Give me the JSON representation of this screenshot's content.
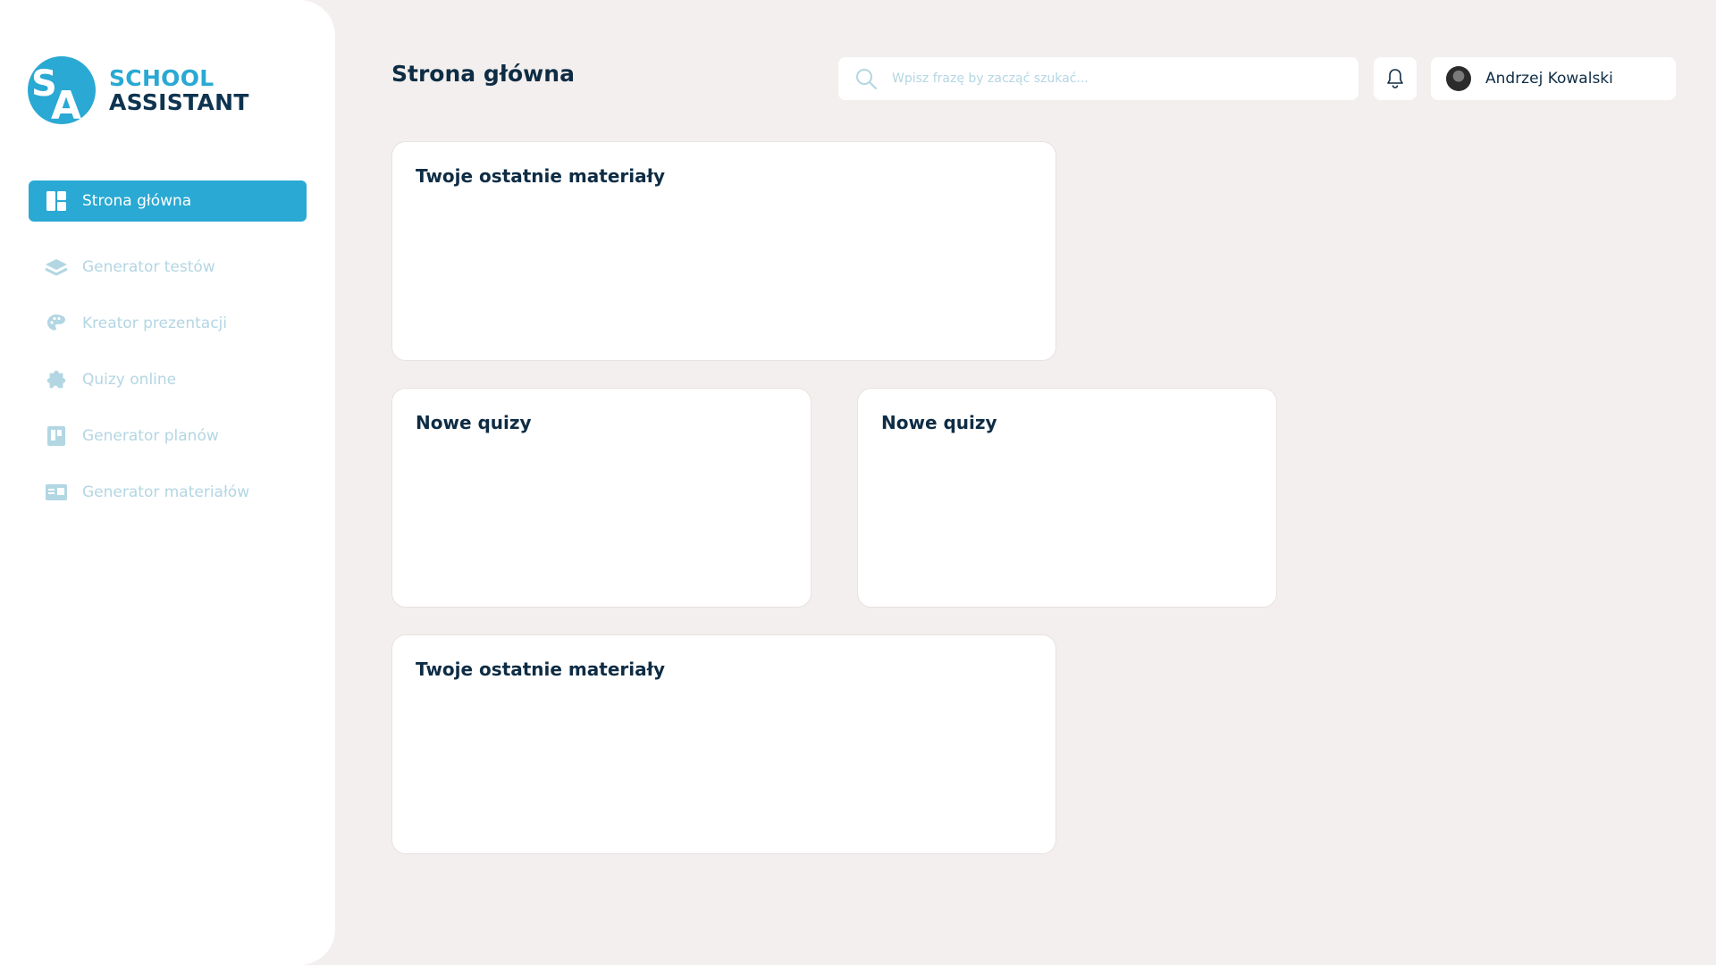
{
  "brand": {
    "logo_letters": "SA",
    "line1": "SCHOOL",
    "line2": "ASSISTANT",
    "primary_color": "#29a9d3",
    "dark_color": "#0e3450"
  },
  "sidebar": {
    "items": [
      {
        "label": "Strona główna",
        "icon": "dashboard-icon",
        "active": true
      },
      {
        "label": "Generator testów",
        "icon": "layers-icon",
        "active": false
      },
      {
        "label": "Kreator prezentacji",
        "icon": "palette-icon",
        "active": false
      },
      {
        "label": "Quizy online",
        "icon": "puzzle-icon",
        "active": false
      },
      {
        "label": "Generator planów",
        "icon": "board-icon",
        "active": false
      },
      {
        "label": "Generator materiałów",
        "icon": "id-card-icon",
        "active": false
      }
    ]
  },
  "header": {
    "title": "Strona główna",
    "search_placeholder": "Wpisz frazę by zacząć szukać...",
    "user_name": "Andrzej Kowalski"
  },
  "cards": [
    {
      "title": "Twoje ostatnie materiały"
    },
    {
      "title": "Nowe quizy"
    },
    {
      "title": "Nowe quizy"
    },
    {
      "title": "Twoje ostatnie materiały"
    }
  ],
  "colors": {
    "background": "#f3efee",
    "accent": "#29a9d3",
    "muted_nav": "#b3d6e3",
    "text": "#0e2c44"
  }
}
